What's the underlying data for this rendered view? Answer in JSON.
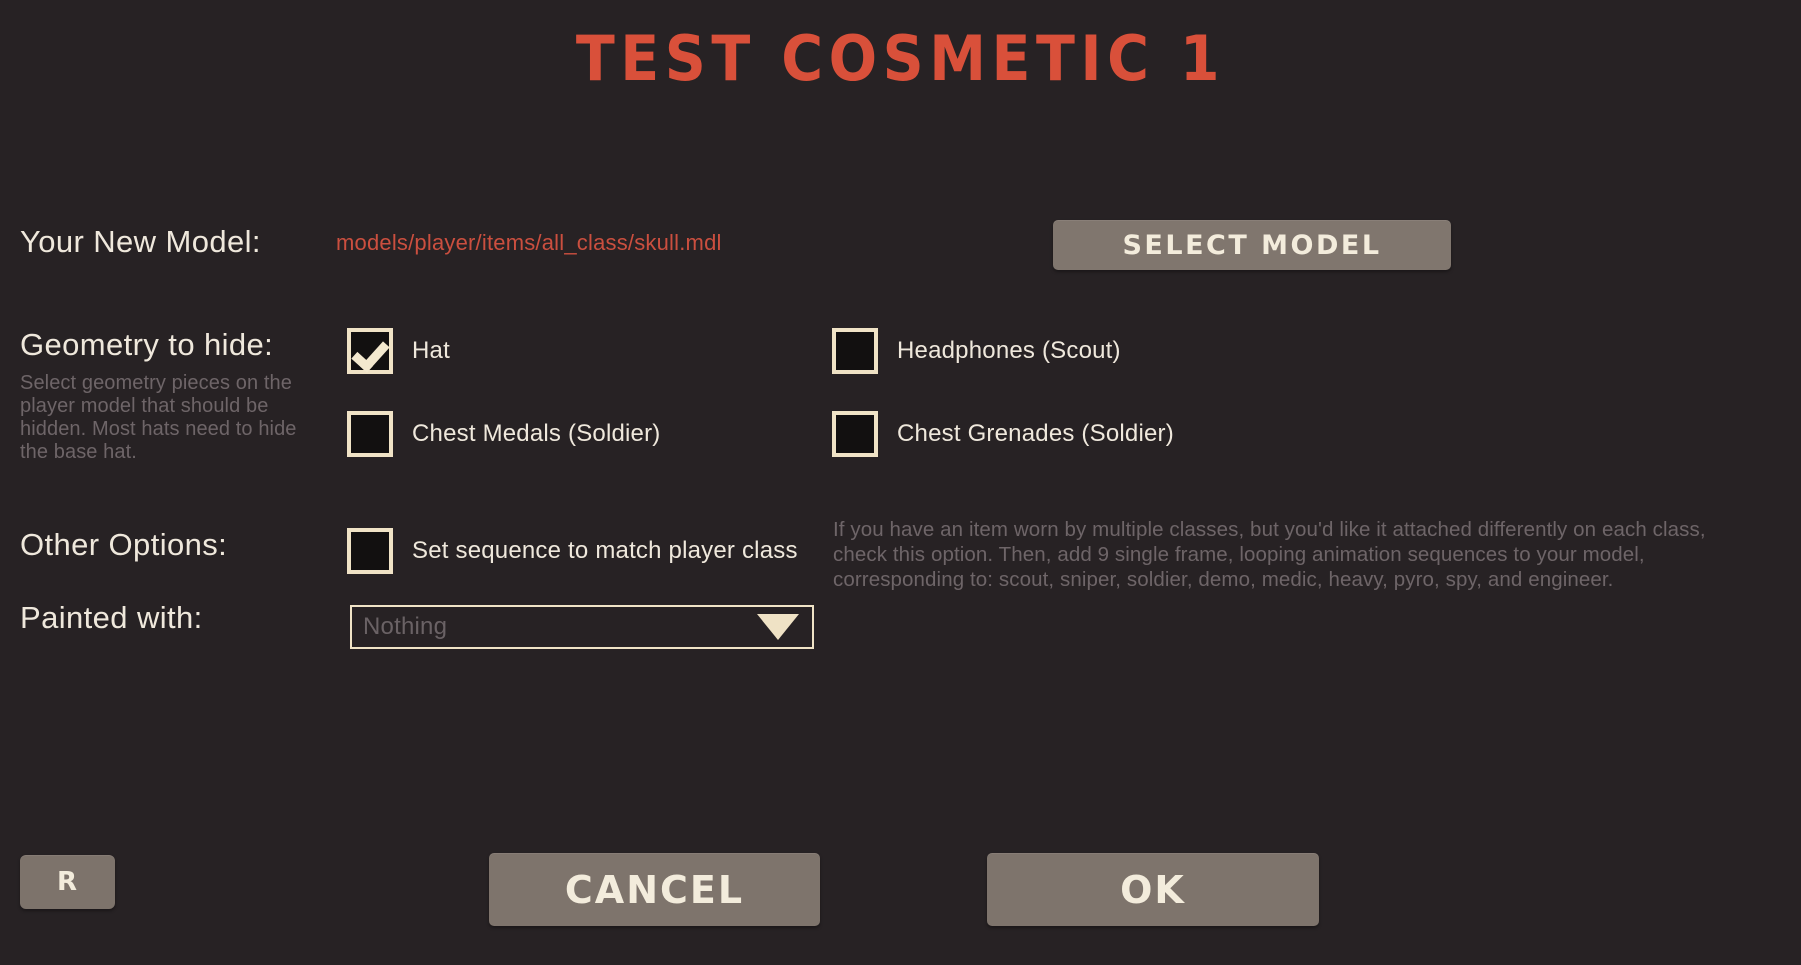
{
  "title": "TEST COSMETIC 1",
  "accent_color": "#D9503A",
  "background_color": "#272224",
  "button_color": "#7E746C",
  "checkbox_border_color": "#F0E3C6",
  "model_row": {
    "label": "Your New Model:",
    "path": "models/player/items/all_class/skull.mdl",
    "select_button": "SELECT MODEL"
  },
  "geometry": {
    "label": "Geometry to hide:",
    "helper": "Select geometry pieces on the player model that should be hidden. Most hats need to hide the base hat.",
    "options": [
      {
        "label": "Hat",
        "checked": true
      },
      {
        "label": "Headphones (Scout)",
        "checked": false
      },
      {
        "label": "Chest Medals (Soldier)",
        "checked": false
      },
      {
        "label": "Chest Grenades (Soldier)",
        "checked": false
      }
    ]
  },
  "other_options": {
    "label": "Other Options:",
    "sequence": {
      "label": "Set sequence to match player class",
      "checked": false
    },
    "info": "If you have an item worn by multiple classes, but you'd like it attached differently on each class, check this option. Then, add 9 single frame, looping animation sequences to your model, corresponding to: scout, sniper, soldier, demo, medic, heavy, pyro, spy, and engineer."
  },
  "paint": {
    "label": "Painted with:",
    "value": "Nothing"
  },
  "footer": {
    "reset_label": "R",
    "cancel_label": "CANCEL",
    "ok_label": "OK"
  }
}
